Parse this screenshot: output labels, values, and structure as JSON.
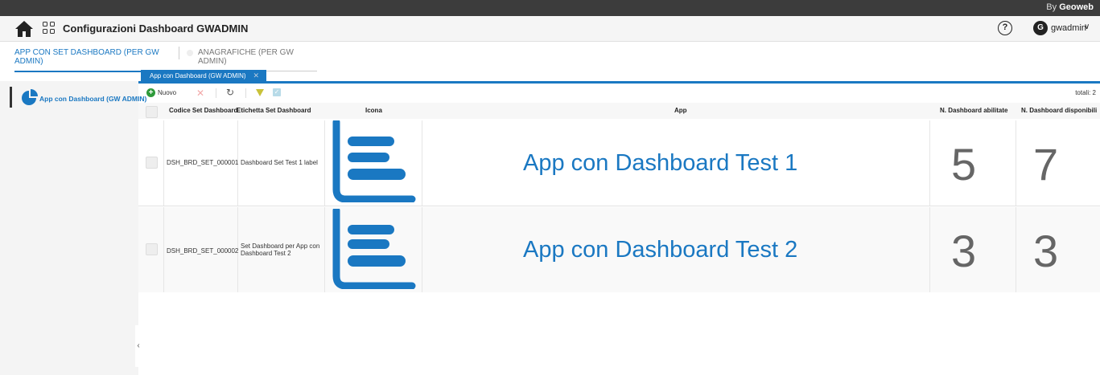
{
  "topbar": {
    "by_prefix": "By",
    "brand": "Geoweb"
  },
  "header": {
    "title": "Configurazioni Dashboard GWADMIN",
    "help": "?",
    "user_initial": "G",
    "user_name": "gwadmin",
    "user_chevron": "∨"
  },
  "main_tabs": [
    {
      "label": "APP CON SET DASHBOARD (PER GW ADMIN)",
      "active": true
    },
    {
      "label": "ANAGRAFICHE (PER GW ADMIN)",
      "active": false
    }
  ],
  "sidebar": {
    "items": [
      {
        "label": "App con Dashboard (GW ADMIN)",
        "icon": "pie-chart-icon"
      }
    ],
    "collapse": "‹"
  },
  "subtab": {
    "label": "App con Dashboard (GW ADMIN)",
    "close": "✕"
  },
  "toolbar": {
    "new_label": "Nuovo",
    "totals": "totali: 2"
  },
  "table": {
    "columns": [
      "Codice Set Dashboard",
      "Etichetta Set Dashboard",
      "Icona",
      "App",
      "N. Dashboard abilitate",
      "N. Dashboard disponibili"
    ],
    "rows": [
      {
        "code": "DSH_BRD_SET_000001",
        "label": "Dashboard Set Test 1 label",
        "app": "App con Dashboard Test 1",
        "enabled": "5",
        "available": "7"
      },
      {
        "code": "DSH_BRD_SET_000002",
        "label": "Set Dashboard per App con Dashboard Test 2",
        "app": "App con Dashboard Test 2",
        "enabled": "3",
        "available": "3"
      }
    ]
  },
  "colors": {
    "accent": "#1a78c2",
    "topbar": "#3c3c3c",
    "new_button": "#2e9a3a"
  }
}
